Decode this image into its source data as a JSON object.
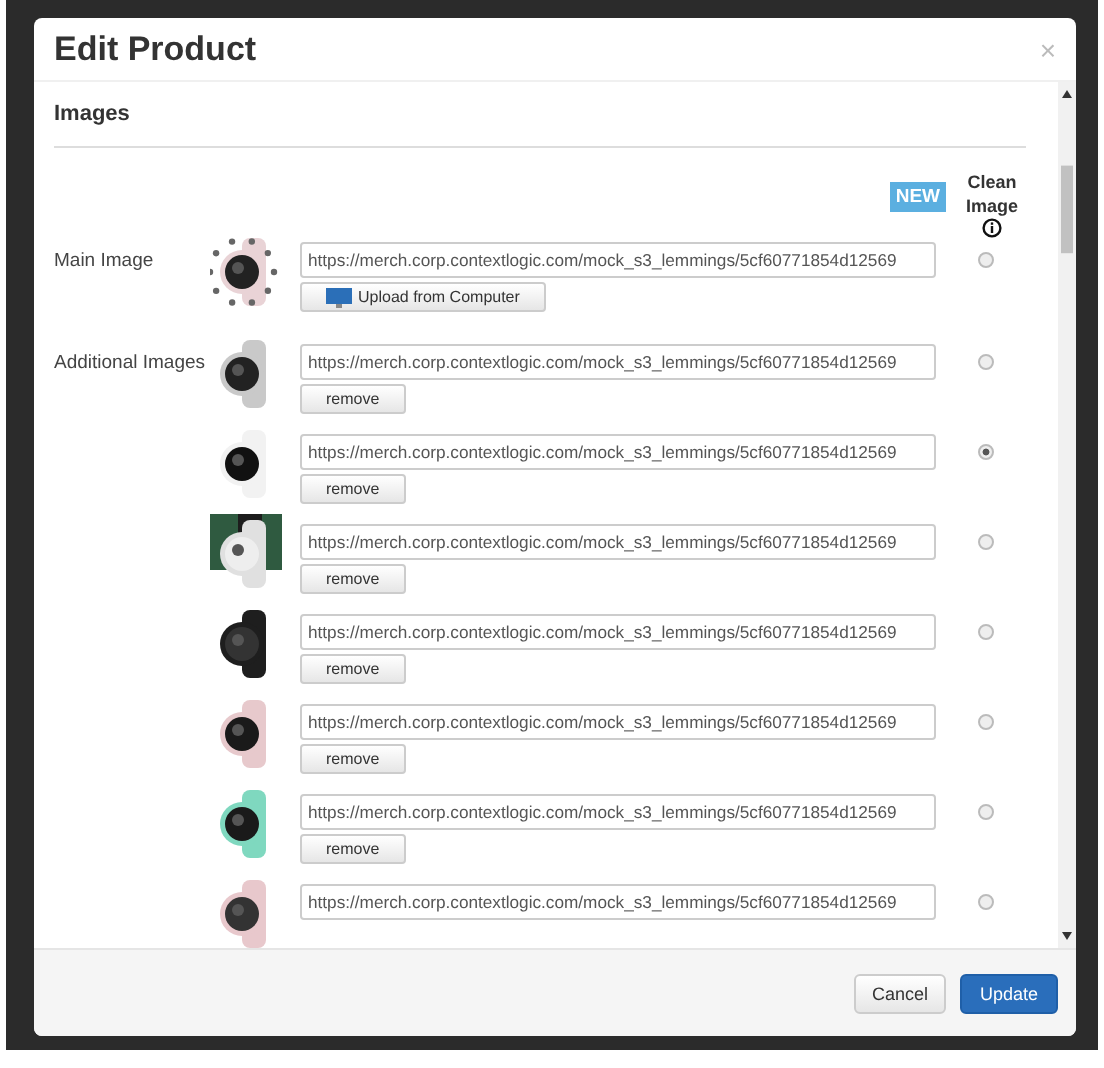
{
  "dialog": {
    "title": "Edit Product",
    "close": "×"
  },
  "section": {
    "title": "Images",
    "badge": "NEW",
    "column_title": "Clean Image"
  },
  "main_image": {
    "label": "Main Image",
    "url": "https://merch.corp.contextlogic.com/mock_s3_lemmings/5cf60771854d12569",
    "button": "Upload from Computer",
    "selected": false
  },
  "additional_images": {
    "label": "Additional Images",
    "items": [
      {
        "url": "https://merch.corp.contextlogic.com/mock_s3_lemmings/5cf60771854d12569",
        "button": "remove",
        "selected": false
      },
      {
        "url": "https://merch.corp.contextlogic.com/mock_s3_lemmings/5cf60771854d12569",
        "button": "remove",
        "selected": true
      },
      {
        "url": "https://merch.corp.contextlogic.com/mock_s3_lemmings/5cf60771854d12569",
        "button": "remove",
        "selected": false
      },
      {
        "url": "https://merch.corp.contextlogic.com/mock_s3_lemmings/5cf60771854d12569",
        "button": "remove",
        "selected": false
      },
      {
        "url": "https://merch.corp.contextlogic.com/mock_s3_lemmings/5cf60771854d12569",
        "button": "remove",
        "selected": false
      },
      {
        "url": "https://merch.corp.contextlogic.com/mock_s3_lemmings/5cf60771854d12569",
        "button": "remove",
        "selected": false
      },
      {
        "url": "https://merch.corp.contextlogic.com/mock_s3_lemmings/5cf60771854d12569",
        "selected": false
      }
    ]
  },
  "footer": {
    "cancel": "Cancel",
    "submit": "Update"
  }
}
